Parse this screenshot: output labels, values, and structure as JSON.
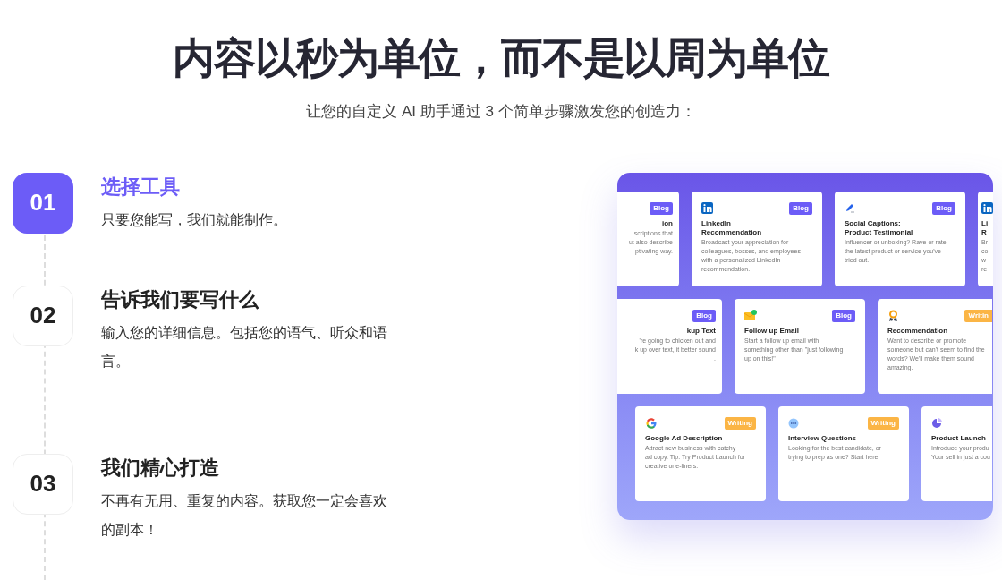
{
  "heading": "内容以秒为单位，而不是以周为单位",
  "subtitle": "让您的自定义 AI 助手通过 3 个简单步骤激发您的创造力：",
  "steps": [
    {
      "number": "01",
      "title": "选择工具",
      "description": "只要您能写，我们就能制作。",
      "selected": true
    },
    {
      "number": "02",
      "title": "告诉我们要写什么",
      "description": "输入您的详细信息。包括您的语气、听众和语言。",
      "selected": false
    },
    {
      "number": "03",
      "title": "我们精心打造",
      "description": "不再有无用、重复的内容。获取您一定会喜欢的副本！",
      "selected": false
    }
  ],
  "preview": {
    "rows": [
      {
        "cards": [
          {
            "kind": "plain",
            "tag": {
              "label": "Blog",
              "color": "#6c5cf7"
            },
            "title": [
              "ion"
            ],
            "lines": [
              "scriptions that",
              "ut also describe",
              "ptivating way."
            ]
          },
          {
            "kind": "linkedin",
            "tag": {
              "label": "Blog",
              "color": "#6c5cf7"
            },
            "title": [
              "LinkedIn",
              "Recommendation"
            ],
            "lines": [
              "Broadcast your appreciation for",
              "colleagues, bosses, and employees",
              "with a personalized LinkedIn",
              "recommendation."
            ]
          },
          {
            "kind": "pen",
            "tag": {
              "label": "Blog",
              "color": "#6c5cf7"
            },
            "title": [
              "Social Captions:",
              "Product Testimonial"
            ],
            "lines": [
              "Influencer or unboxing? Rave or rate",
              "the latest product or service you've",
              "tried out."
            ]
          },
          {
            "kind": "linkedin",
            "title": [
              "Li",
              "R"
            ],
            "lines": [
              "Br",
              "co",
              "w",
              "re"
            ]
          }
        ]
      },
      {
        "cards": [
          {
            "kind": "plain",
            "tag": {
              "label": "Blog",
              "color": "#6c5cf7"
            },
            "title": [
              "kup Text"
            ],
            "lines": [
              "'re going to chicken out and",
              "k up over text, it better sound",
              "."
            ]
          },
          {
            "kind": "mail",
            "tag": {
              "label": "Blog",
              "color": "#6c5cf7"
            },
            "title": [
              "Follow up Email"
            ],
            "lines": [
              "Start a follow up email with",
              "something other than \"just following",
              "up on this!\""
            ]
          },
          {
            "kind": "award",
            "tag": {
              "label": "Writin",
              "color": "#fbb545"
            },
            "title": [
              "Recommendation"
            ],
            "lines": [
              "Want to describe or promote",
              "someone but can't seem to find the",
              "words? We'll make them sound",
              "amazing."
            ]
          }
        ]
      },
      {
        "cards": [
          {
            "kind": "google",
            "tag": {
              "label": "Writing",
              "color": "#fbb545"
            },
            "title": [
              "Google Ad Description"
            ],
            "lines": [
              "Attract new business with catchy",
              "ad copy. Tip: Try Product Launch for",
              "creative one-liners."
            ]
          },
          {
            "kind": "chat",
            "tag": {
              "label": "Writing",
              "color": "#fbb545"
            },
            "title": [
              "Interview Questions"
            ],
            "lines": [
              "Looking for the best candidate, or",
              "trying to prep as one? Start here."
            ]
          },
          {
            "kind": "pie",
            "title": [
              "Product Launch"
            ],
            "lines": [
              "Introduce your produ",
              "Your sell in just a cou"
            ]
          }
        ]
      }
    ]
  }
}
